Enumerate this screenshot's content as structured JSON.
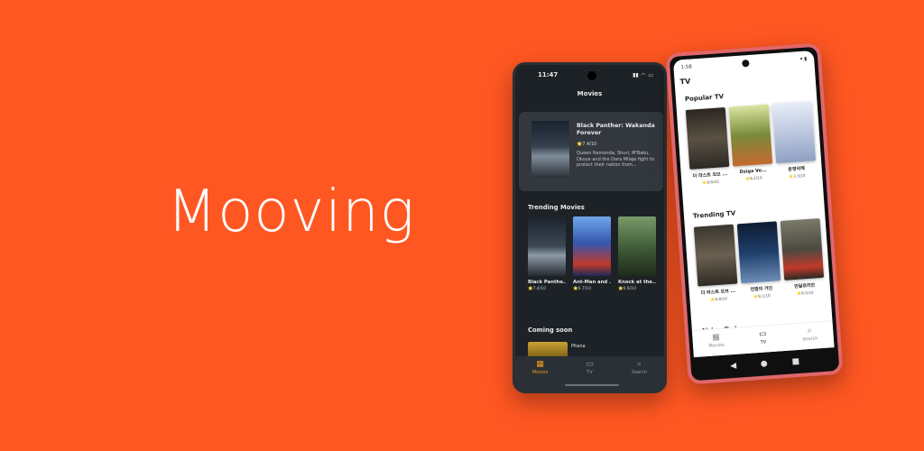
{
  "brand": {
    "title": "Mooving",
    "background": "#FF5722",
    "accent": "#F39C12"
  },
  "phone1": {
    "status_time": "11:47",
    "header": "Movies",
    "hero": {
      "title": "Black Panther: Wakanda Forever",
      "rating": "⭐7.4/10",
      "description": "Queen Ramonda, Shuri, M'Baku, Okoye and the Dora Milaje fight to protect their nation from..."
    },
    "trending_title": "Trending Movies",
    "trending": [
      {
        "title": "Black Panthe...",
        "rating": "⭐7.4/10",
        "poster": "#2c3540"
      },
      {
        "title": "Ant-Man and ...",
        "rating": "⭐6.7/10",
        "poster": "#3b66b8"
      },
      {
        "title": "Knock at the...",
        "rating": "⭐6.6/10",
        "poster": "#3e5a3a"
      }
    ],
    "coming_title": "Coming soon",
    "coming_item": "Pitana",
    "tabs": [
      {
        "label": "Movies",
        "icon": "film-icon"
      },
      {
        "label": "TV",
        "icon": "tv-icon"
      },
      {
        "label": "Search",
        "icon": "search-icon"
      }
    ]
  },
  "phone2": {
    "status_time": "1:58",
    "header": "TV",
    "popular_title": "Popular TV",
    "popular": [
      {
        "title": "더 라스트 오브 ...",
        "rating": "⭐8.8/10",
        "poster": "#2f2a22"
      },
      {
        "title": "Dziga Ve...",
        "rating": "⭐6.2/10",
        "poster": "#7a8a3a"
      },
      {
        "title": "운명의해",
        "rating": "⭐3.3/10",
        "poster": "#bcc8de"
      }
    ],
    "trending_title": "Trending TV",
    "trending": [
      {
        "title": "더 라스트 오브 ...",
        "rating": "⭐8.8/10",
        "poster": "#3a3630"
      },
      {
        "title": "전쟁의 거인",
        "rating": "⭐8.1/10",
        "poster": "#1f3f6b"
      },
      {
        "title": "만달로리안",
        "rating": "⭐8.5/10",
        "poster": "#4a4a40"
      }
    ],
    "airing_title": "Airing Today",
    "tabs": [
      {
        "label": "Movies",
        "icon": "film-icon"
      },
      {
        "label": "TV",
        "icon": "tv-icon"
      },
      {
        "label": "Search",
        "icon": "search-icon"
      }
    ]
  }
}
